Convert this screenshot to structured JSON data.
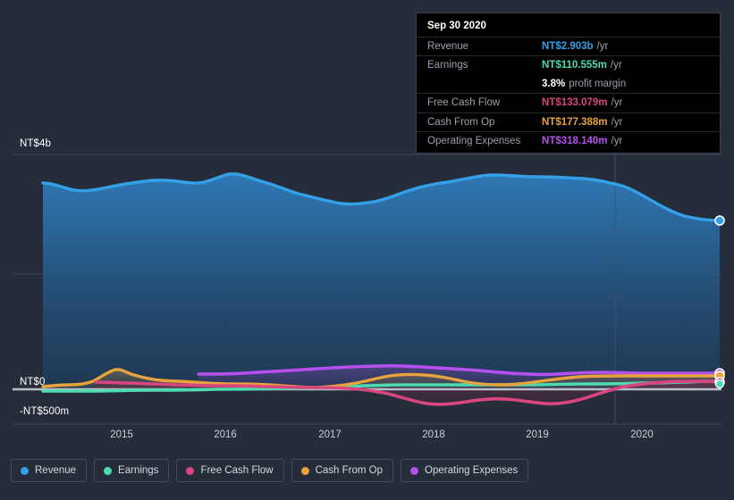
{
  "colors": {
    "background": "#262d3a",
    "revenue": "#33a0e8",
    "earnings": "#4ddbb0",
    "free_cash_flow": "#d9457f",
    "cash_from_op": "#e8a33d",
    "operating_expenses": "#b64ff0",
    "gridline": "#3c4455",
    "zero_line": "#c9ced8",
    "tooltip_bg": "#000000",
    "tooltip_border": "#3a4050"
  },
  "tooltip": {
    "date": "Sep 30 2020",
    "rows": [
      {
        "key": "Revenue",
        "value": "NT$2.903b",
        "unit": "/yr",
        "color": "#33a0e8"
      },
      {
        "key": "Earnings",
        "value": "NT$110.555m",
        "unit": "/yr",
        "color": "#4ddbb0"
      },
      {
        "key": "",
        "value": "3.8%",
        "unit": "profit margin",
        "color": "#ffffff"
      },
      {
        "key": "Free Cash Flow",
        "value": "NT$133.079m",
        "unit": "/yr",
        "color": "#d9457f"
      },
      {
        "key": "Cash From Op",
        "value": "NT$177.388m",
        "unit": "/yr",
        "color": "#e8a33d"
      },
      {
        "key": "Operating Expenses",
        "value": "NT$318.140m",
        "unit": "/yr",
        "color": "#b64ff0"
      }
    ]
  },
  "legend": {
    "items": [
      {
        "label": "Revenue",
        "color": "#33a0e8"
      },
      {
        "label": "Earnings",
        "color": "#4ddbb0"
      },
      {
        "label": "Free Cash Flow",
        "color": "#d9457f"
      },
      {
        "label": "Cash From Op",
        "color": "#e8a33d"
      },
      {
        "label": "Operating Expenses",
        "color": "#b64ff0"
      }
    ]
  },
  "axes": {
    "y_top_label": "NT$4b",
    "y_zero_label": "NT$0",
    "y_bottom_label": "-NT$500m",
    "x_labels": [
      "2015",
      "2016",
      "2017",
      "2018",
      "2019",
      "2020"
    ]
  },
  "chart_data": {
    "type": "area",
    "title": "",
    "subtitle": "",
    "xlabel": "",
    "ylabel": "NT$",
    "ylim": [
      -500000000,
      4000000000
    ],
    "y_ticks": [
      {
        "label": "NT$4b",
        "value": 4000000000
      },
      {
        "label": "NT$0",
        "value": 0
      },
      {
        "label": "-NT$500m",
        "value": -500000000
      }
    ],
    "x": [
      "2014.4",
      "2014.7",
      "2015.0",
      "2015.3",
      "2015.6",
      "2015.9",
      "2016.2",
      "2016.5",
      "2016.8",
      "2017.1",
      "2017.4",
      "2017.7",
      "2018.0",
      "2018.3",
      "2018.6",
      "2018.9",
      "2019.2",
      "2019.5",
      "2019.8",
      "2020.1",
      "2020.4",
      "2020.75"
    ],
    "x_ticks": [
      "2015",
      "2016",
      "2017",
      "2018",
      "2019",
      "2020"
    ],
    "grid": true,
    "legend_position": "bottom-left",
    "currency": "NT$",
    "units": "per year",
    "forecast_divider_x": "2019.85",
    "series": [
      {
        "name": "Revenue",
        "color": "#33a0e8",
        "filled": true,
        "values": [
          3.42,
          3.32,
          3.3,
          3.34,
          3.4,
          3.42,
          3.41,
          3.38,
          3.46,
          3.43,
          3.33,
          3.22,
          3.18,
          3.27,
          3.34,
          3.52,
          3.56,
          3.55,
          3.52,
          3.46,
          3.43,
          2.903
        ],
        "unit": "NT$b",
        "last_value": "NT$2.903b"
      },
      {
        "name": "Earnings",
        "color": "#4ddbb0",
        "filled": false,
        "values": [
          -0.02,
          -0.018,
          -0.015,
          -0.014,
          -0.012,
          -0.01,
          -0.008,
          -0.006,
          -0.005,
          -0.004,
          -0.002,
          0.004,
          0.012,
          0.02,
          0.03,
          0.04,
          0.046,
          0.048,
          0.044,
          0.06,
          0.085,
          0.1106
        ],
        "unit": "NT$b",
        "last_value": "NT$110.555m"
      },
      {
        "name": "Free Cash Flow",
        "color": "#d9457f",
        "filled": false,
        "values": [
          null,
          null,
          -0.03,
          -0.03,
          -0.032,
          -0.034,
          -0.036,
          -0.04,
          -0.046,
          -0.05,
          -0.056,
          -0.062,
          -0.09,
          -0.215,
          -0.235,
          -0.19,
          -0.215,
          -0.2,
          -0.12,
          -0.04,
          0.06,
          0.1331
        ],
        "unit": "NT$b",
        "last_value": "NT$133.079m"
      },
      {
        "name": "Cash From Op",
        "color": "#e8a33d",
        "filled": true,
        "values": [
          0.01,
          0.016,
          0.005,
          0.06,
          0.2,
          0.25,
          0.15,
          0.075,
          0.065,
          0.06,
          0.055,
          0.05,
          0.04,
          0.025,
          0.06,
          0.14,
          0.2,
          0.19,
          0.11,
          0.07,
          0.12,
          0.1774
        ],
        "unit": "NT$b",
        "last_value": "NT$177.388m"
      },
      {
        "name": "Operating Expenses",
        "color": "#b64ff0",
        "filled": false,
        "values": [
          null,
          null,
          null,
          null,
          0.268,
          0.268,
          0.272,
          0.276,
          0.28,
          0.282,
          0.286,
          0.292,
          0.3,
          0.312,
          0.322,
          0.33,
          0.328,
          0.322,
          0.312,
          0.31,
          0.314,
          0.3181
        ],
        "unit": "NT$b",
        "last_value": "NT$318.140m"
      }
    ]
  }
}
